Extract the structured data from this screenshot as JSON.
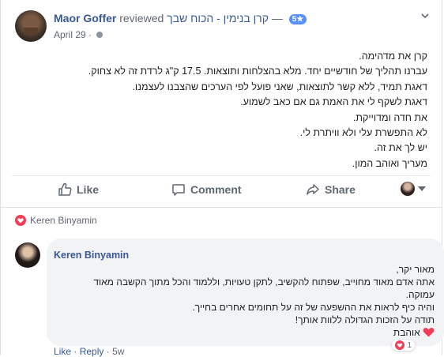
{
  "post": {
    "author": "Maor Goffer",
    "action": "reviewed",
    "page_name": "קרן בנימין - הכוח שבך",
    "separator": "—",
    "rating": "5★",
    "date": "April 29",
    "dot": "·",
    "lines": [
      "קרן את מדהימה.",
      "עברנו תהליך של חודשיים יחד. מלא בהצלחות ותוצאות. 17.5 ק\"ג לרדת זה לא צחוק.",
      "דאגת תמיד, ללא קשר לתוצאות, שאני פועל לפי הערכים שהצבנו לעצמנו.",
      "דאגת לשקף לי את האמת גם אם כאב לשמוע.",
      "את חדה ומדוייקת.",
      "לא התפשרת עלי ולא וויתרת לי.",
      "יש לך את זה.",
      "מעריך ואוהב המון."
    ]
  },
  "actions": {
    "like": "Like",
    "comment": "Comment",
    "share": "Share"
  },
  "reactions": {
    "name": "Keren Binyamin"
  },
  "comment": {
    "author": "Keren Binyamin",
    "lines": [
      "מאור יקר,",
      "אתה אדם מאוד מחוייב, שפתוח להקשיב, לתקן טעויות, וללמוד והכל מתוך הקשבה מאוד",
      "עמוקה.",
      "והיה כיף לראות את ההשפעה של זה על תחומים אחרים בחייך.",
      "תודה על הזכות הגדולה ללוות אותך!",
      "אוהבת"
    ],
    "reaction_count": "1",
    "like": "Like",
    "dot": "·",
    "reply": "Reply",
    "time": "5w"
  },
  "colors": {
    "link": "#385898",
    "muted": "#606770",
    "heart": "#f33e58",
    "rating_badge": "#5890ff"
  }
}
